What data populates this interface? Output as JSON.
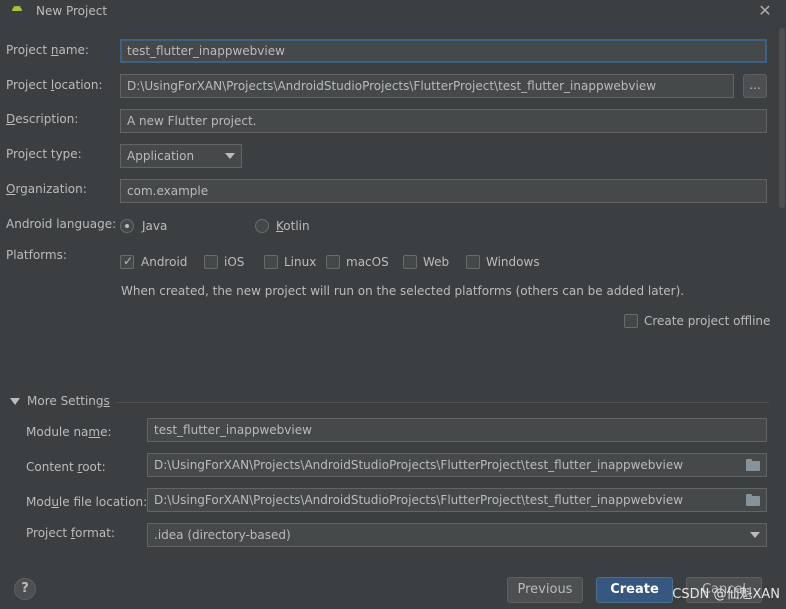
{
  "window": {
    "title": "New Project"
  },
  "form": {
    "project_name": {
      "label": "Project name:",
      "value": "test_flutter_inappwebview"
    },
    "project_location": {
      "label": "Project location:",
      "value": "D:\\UsingForXAN\\Projects\\AndroidStudioProjects\\FlutterProject\\test_flutter_inappwebview",
      "browse": "..."
    },
    "description": {
      "label": "Description:",
      "value": "A new Flutter project."
    },
    "project_type": {
      "label": "Project type:",
      "value": "Application"
    },
    "organization": {
      "label": "Organization:",
      "value": "com.example"
    },
    "android_language": {
      "label": "Android language:",
      "options": [
        {
          "label": "Java",
          "selected": true
        },
        {
          "label": "Kotlin",
          "selected": false
        }
      ]
    },
    "platforms": {
      "label": "Platforms:",
      "options": [
        {
          "label": "Android",
          "checked": true
        },
        {
          "label": "iOS",
          "checked": false
        },
        {
          "label": "Linux",
          "checked": false
        },
        {
          "label": "macOS",
          "checked": false
        },
        {
          "label": "Web",
          "checked": false
        },
        {
          "label": "Windows",
          "checked": false
        }
      ],
      "hint": "When created, the new project will run on the selected platforms (others can be added later)."
    },
    "offline": {
      "label": "Create project offline",
      "checked": false
    }
  },
  "more_settings": {
    "title": "More Settings",
    "module_name": {
      "label": "Module name:",
      "value": "test_flutter_inappwebview"
    },
    "content_root": {
      "label": "Content root:",
      "value": "D:\\UsingForXAN\\Projects\\AndroidStudioProjects\\FlutterProject\\test_flutter_inappwebview"
    },
    "module_file_location": {
      "label": "Module file location:",
      "value": "D:\\UsingForXAN\\Projects\\AndroidStudioProjects\\FlutterProject\\test_flutter_inappwebview"
    },
    "project_format": {
      "label": "Project format:",
      "value": ".idea (directory-based)"
    }
  },
  "footer": {
    "help": "?",
    "previous": "Previous",
    "create": "Create",
    "cancel": "Cancel",
    "watermark": "CSDN @仙魁XAN"
  },
  "colors": {
    "background": "#3c3f41",
    "field": "#45494a",
    "primary_button": "#365880",
    "focus_border": "#3d6185"
  }
}
